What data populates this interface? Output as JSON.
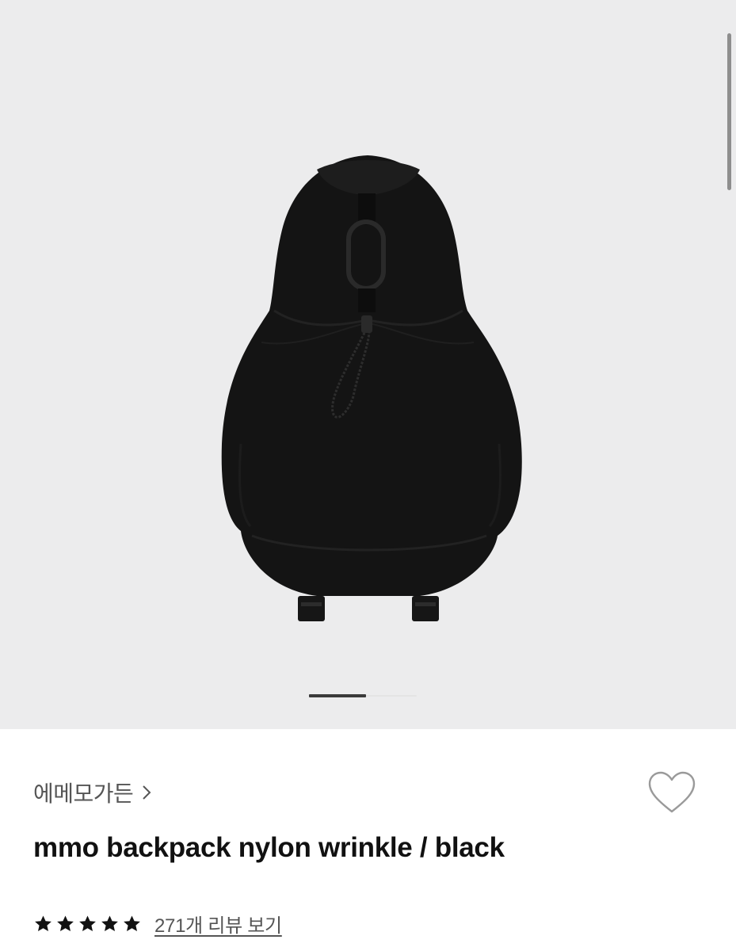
{
  "gallery": {
    "image_alt": "mmo backpack nylon wrinkle / black",
    "current_index": 1,
    "pager_progress": 0.53
  },
  "product": {
    "brand": "에메모가든",
    "title": "mmo backpack nylon wrinkle / black",
    "rating_stars": 5,
    "review_link": "271개 리뷰 보기"
  },
  "icons": {
    "brand": "chevron-right-icon",
    "like": "heart-outline-icon",
    "star": "star-filled-icon"
  },
  "colors": {
    "gallery_bg": "#ececed",
    "backpack": "#141414",
    "text_primary": "#111111",
    "text_secondary": "#555555"
  }
}
